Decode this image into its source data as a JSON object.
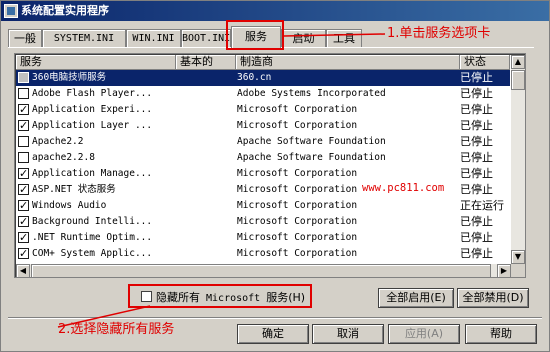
{
  "window": {
    "title": "系统配置实用程序"
  },
  "tabs": [
    {
      "label": "一般",
      "active": false
    },
    {
      "label": "SYSTEM.INI",
      "active": false
    },
    {
      "label": "WIN.INI",
      "active": false
    },
    {
      "label": "BOOT.INI",
      "active": false
    },
    {
      "label": "服务",
      "active": true
    },
    {
      "label": "启动",
      "active": false
    },
    {
      "label": "工具",
      "active": false
    }
  ],
  "annotations": {
    "step1": "1.单击服务选项卡",
    "step2": "2.选择隐藏所有服务",
    "watermark": "www.pc811.com"
  },
  "columns": [
    "服务",
    "基本的",
    "制造商",
    "状态"
  ],
  "rows": [
    {
      "name": "360电脑技师服务",
      "essential": "",
      "manufacturer": "360.cn",
      "status": "已停止",
      "checked": false,
      "selected": true
    },
    {
      "name": "Adobe Flash Player...",
      "essential": "",
      "manufacturer": "Adobe Systems Incorporated",
      "status": "已停止",
      "checked": false,
      "selected": false
    },
    {
      "name": "Application Experi...",
      "essential": "",
      "manufacturer": "Microsoft Corporation",
      "status": "已停止",
      "checked": true,
      "selected": false
    },
    {
      "name": "Application Layer ...",
      "essential": "",
      "manufacturer": "Microsoft Corporation",
      "status": "已停止",
      "checked": true,
      "selected": false
    },
    {
      "name": "Apache2.2",
      "essential": "",
      "manufacturer": "Apache Software Foundation",
      "status": "已停止",
      "checked": false,
      "selected": false
    },
    {
      "name": "apache2.2.8",
      "essential": "",
      "manufacturer": "Apache Software Foundation",
      "status": "已停止",
      "checked": false,
      "selected": false
    },
    {
      "name": "Application Manage...",
      "essential": "",
      "manufacturer": "Microsoft Corporation",
      "status": "已停止",
      "checked": true,
      "selected": false
    },
    {
      "name": "ASP.NET 状态服务",
      "essential": "",
      "manufacturer": "Microsoft Corporation",
      "status": "已停止",
      "checked": true,
      "selected": false
    },
    {
      "name": "Windows Audio",
      "essential": "",
      "manufacturer": "Microsoft Corporation",
      "status": "正在运行",
      "checked": true,
      "selected": false
    },
    {
      "name": "Background Intelli...",
      "essential": "",
      "manufacturer": "Microsoft Corporation",
      "status": "已停止",
      "checked": true,
      "selected": false
    },
    {
      "name": ".NET Runtime Optim...",
      "essential": "",
      "manufacturer": "Microsoft Corporation",
      "status": "已停止",
      "checked": true,
      "selected": false
    },
    {
      "name": "COM+ System Applic...",
      "essential": "",
      "manufacturer": "Microsoft Corporation",
      "status": "已停止",
      "checked": true,
      "selected": false
    }
  ],
  "hide_ms": {
    "label": "隐藏所有",
    "label_mono": " Microsoft ",
    "label_tail": "服务(H)",
    "checked": false
  },
  "buttons": {
    "enable_all": "全部启用(E)",
    "disable_all": "全部禁用(D)",
    "ok": "确定",
    "cancel": "取消",
    "apply": "应用(A)",
    "help": "帮助"
  },
  "colors": {
    "annotation": "#e00000",
    "selection": "#0a246a",
    "face": "#d4d0c8"
  }
}
